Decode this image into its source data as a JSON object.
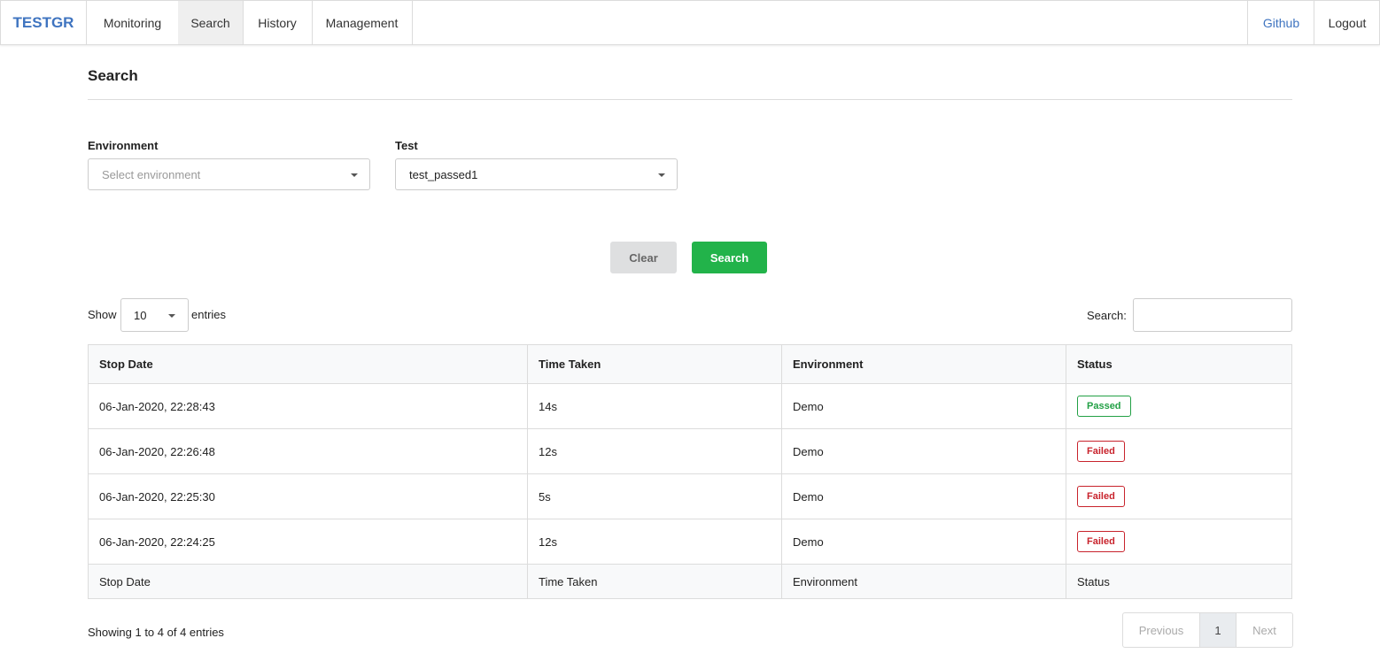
{
  "navbar": {
    "brand": "TESTGR",
    "items": [
      {
        "label": "Monitoring"
      },
      {
        "label": "Search",
        "active": true
      },
      {
        "label": "History"
      },
      {
        "label": "Management"
      }
    ],
    "github_label": "Github",
    "logout_label": "Logout"
  },
  "page": {
    "title": "Search"
  },
  "filters": {
    "environment": {
      "label": "Environment",
      "placeholder": "Select environment",
      "value": ""
    },
    "test": {
      "label": "Test",
      "value": "test_passed1"
    },
    "clear_label": "Clear",
    "search_label": "Search"
  },
  "table_controls": {
    "show_label": "Show",
    "length_value": "10",
    "entries_label": "entries",
    "search_label": "Search:",
    "search_value": ""
  },
  "table": {
    "columns": [
      "Stop Date",
      "Time Taken",
      "Environment",
      "Status"
    ],
    "rows": [
      {
        "stop_date": "06-Jan-2020, 22:28:43",
        "time_taken": "14s",
        "environment": "Demo",
        "status": "Passed"
      },
      {
        "stop_date": "06-Jan-2020, 22:26:48",
        "time_taken": "12s",
        "environment": "Demo",
        "status": "Failed"
      },
      {
        "stop_date": "06-Jan-2020, 22:25:30",
        "time_taken": "5s",
        "environment": "Demo",
        "status": "Failed"
      },
      {
        "stop_date": "06-Jan-2020, 22:24:25",
        "time_taken": "12s",
        "environment": "Demo",
        "status": "Failed"
      }
    ]
  },
  "footer": {
    "info": "Showing 1 to 4 of 4 entries",
    "previous_label": "Previous",
    "current_page": "1",
    "next_label": "Next"
  },
  "colors": {
    "brand": "#3f74c0",
    "search_button": "#22b34a",
    "passed": "#22a045",
    "failed": "#c8232c"
  }
}
